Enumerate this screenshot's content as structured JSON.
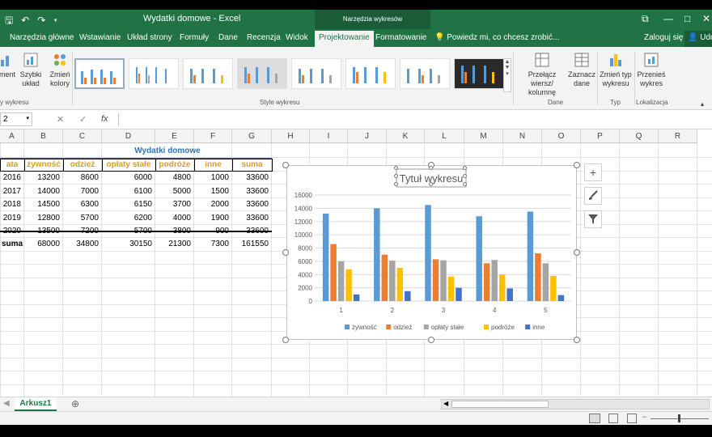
{
  "window": {
    "title": "Wydatki domowe - Excel",
    "context_group": "Narzędzia wykresów",
    "qat_icons": [
      "save-icon",
      "undo-icon",
      "redo-icon",
      "customize-qat-icon"
    ],
    "buttons": {
      "restore": "⧉",
      "minimize": "—",
      "maximize": "□",
      "close": "✕"
    }
  },
  "tabs": [
    "Narzędzia główne",
    "Wstawianie",
    "Układ strony",
    "Formuły",
    "Dane",
    "Recenzja",
    "Widok",
    "Projektowanie",
    "Formatowanie"
  ],
  "active_tab": "Projektowanie",
  "tellme": "Powiedz mi, co chcesz zrobić...",
  "account": {
    "login": "Zaloguj się",
    "share": "Udo"
  },
  "ribbon": {
    "groups": {
      "layouts": "y wykresu",
      "styles": "Style wykresu",
      "data": "Dane",
      "type": "Typ",
      "location": "Lokalizacja"
    },
    "buttons": {
      "add_element": "ment",
      "quick_layout_1": "Szybki",
      "quick_layout_2": "układ",
      "change_colors_1": "Zmień",
      "change_colors_2": "kolory",
      "switch_row_col_1": "Przełącz wiersz/",
      "switch_row_col_2": "kolumnę",
      "select_data_1": "Zaznacz",
      "select_data_2": "dane",
      "change_type_1": "Zmień typ",
      "change_type_2": "wykresu",
      "move_chart_1": "Przenieś",
      "move_chart_2": "wykres"
    }
  },
  "formula_bar": {
    "namebox": "2",
    "cancel": "✕",
    "enter": "✓",
    "fx": "fx",
    "value": ""
  },
  "columns": [
    "A",
    "B",
    "C",
    "D",
    "E",
    "F",
    "G",
    "H",
    "I",
    "J",
    "K",
    "L",
    "M",
    "N",
    "O",
    "P",
    "Q",
    "R"
  ],
  "rows": [
    "",
    "",
    "",
    "",
    "",
    "",
    "",
    "",
    "",
    "",
    "",
    "",
    "",
    "",
    "",
    "",
    "",
    "",
    ""
  ],
  "table": {
    "title": "Wydatki domowe",
    "headers": [
      "ata",
      "żywność",
      "odzież",
      "opłaty stałe",
      "podróże",
      "inne",
      "suma"
    ],
    "rows": [
      [
        "2016",
        "13200",
        "8600",
        "6000",
        "4800",
        "1000",
        "33600"
      ],
      [
        "2017",
        "14000",
        "7000",
        "6100",
        "5000",
        "1500",
        "33600"
      ],
      [
        "2018",
        "14500",
        "6300",
        "6150",
        "3700",
        "2000",
        "33600"
      ],
      [
        "2019",
        "12800",
        "5700",
        "6200",
        "4000",
        "1900",
        "33600"
      ],
      [
        "2020",
        "13500",
        "7200",
        "5700",
        "3800",
        "900",
        "33600"
      ]
    ],
    "total": [
      "suma",
      "68000",
      "34800",
      "30150",
      "21300",
      "7300",
      "161550"
    ]
  },
  "chart_data": {
    "type": "bar",
    "title": "Tytuł wykresu",
    "categories": [
      "1",
      "2",
      "3",
      "4",
      "5"
    ],
    "series": [
      {
        "name": "żywność",
        "values": [
          13200,
          14000,
          14500,
          12800,
          13500
        ],
        "color": "#5b9bd5"
      },
      {
        "name": "odzież",
        "values": [
          8600,
          7000,
          6300,
          5700,
          7200
        ],
        "color": "#ed7d31"
      },
      {
        "name": "opłaty stałe",
        "values": [
          6000,
          6100,
          6150,
          6200,
          5700
        ],
        "color": "#a5a5a5"
      },
      {
        "name": "podróże",
        "values": [
          4800,
          5000,
          3700,
          4000,
          3800
        ],
        "color": "#ffc000"
      },
      {
        "name": "inne",
        "values": [
          1000,
          1500,
          2000,
          1900,
          900
        ],
        "color": "#4472c4"
      }
    ],
    "ylim": [
      0,
      16000
    ],
    "yticks": [
      "0",
      "2000",
      "4000",
      "6000",
      "8000",
      "10000",
      "12000",
      "14000",
      "16000"
    ],
    "grid": true,
    "legend": "bottom"
  },
  "chart_side_buttons": {
    "add": "+",
    "style": "brush-icon",
    "filter": "filter-icon"
  },
  "sheet": {
    "active": "Arkusz1",
    "add": "⊕"
  },
  "colors": {
    "excel_green": "#217346",
    "header_gold": "#d6a01f",
    "table_title": "#2e75b6"
  }
}
